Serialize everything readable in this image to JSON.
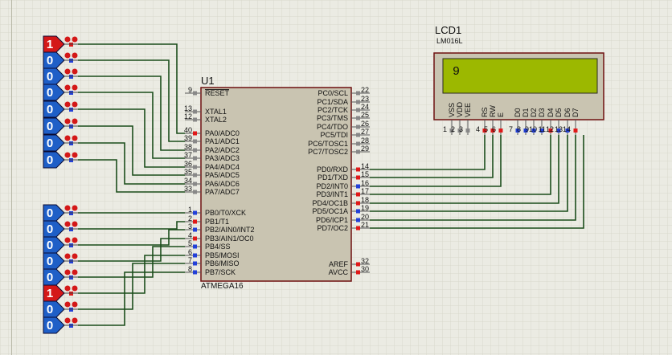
{
  "lcd": {
    "ref": "LCD1",
    "model": "LM016L",
    "display_text": "9",
    "pins": [
      "VSS",
      "VDD",
      "VEE",
      "RS",
      "RW",
      "E",
      "D0",
      "D1",
      "D2",
      "D3",
      "D4",
      "D5",
      "D6",
      "D7"
    ],
    "pin_numbers": [
      "1",
      "2",
      "3",
      "4",
      "5",
      "6",
      "7",
      "8",
      "9",
      "10",
      "11",
      "12",
      "13",
      "14"
    ]
  },
  "mcu": {
    "ref": "U1",
    "model": "ATMEGA16",
    "left_pins": [
      {
        "num": "9",
        "name": "RESET"
      },
      {
        "num": "13",
        "name": "XTAL1"
      },
      {
        "num": "12",
        "name": "XTAL2"
      },
      {
        "num": "40",
        "name": "PA0/ADC0"
      },
      {
        "num": "39",
        "name": "PA1/ADC1"
      },
      {
        "num": "38",
        "name": "PA2/ADC2"
      },
      {
        "num": "37",
        "name": "PA3/ADC3"
      },
      {
        "num": "36",
        "name": "PA4/ADC4"
      },
      {
        "num": "35",
        "name": "PA5/ADC5"
      },
      {
        "num": "34",
        "name": "PA6/ADC6"
      },
      {
        "num": "33",
        "name": "PA7/ADC7"
      },
      {
        "num": "1",
        "name": "PB0/T0/XCK"
      },
      {
        "num": "2",
        "name": "PB1/T1"
      },
      {
        "num": "3",
        "name": "PB2/AIN0/INT2"
      },
      {
        "num": "4",
        "name": "PB3/AIN1/OC0"
      },
      {
        "num": "5",
        "name": "PB4/SS"
      },
      {
        "num": "6",
        "name": "PB5/MOSI"
      },
      {
        "num": "7",
        "name": "PB6/MISO"
      },
      {
        "num": "8",
        "name": "PB7/SCK"
      }
    ],
    "right_pins": [
      {
        "num": "22",
        "name": "PC0/SCL"
      },
      {
        "num": "23",
        "name": "PC1/SDA"
      },
      {
        "num": "24",
        "name": "PC2/TCK"
      },
      {
        "num": "25",
        "name": "PC3/TMS"
      },
      {
        "num": "26",
        "name": "PC4/TDO"
      },
      {
        "num": "27",
        "name": "PC5/TDI"
      },
      {
        "num": "28",
        "name": "PC6/TOSC1"
      },
      {
        "num": "29",
        "name": "PC7/TOSC2"
      },
      {
        "num": "14",
        "name": "PD0/RXD"
      },
      {
        "num": "15",
        "name": "PD1/TXD"
      },
      {
        "num": "16",
        "name": "PD2/INT0"
      },
      {
        "num": "17",
        "name": "PD3/INT1"
      },
      {
        "num": "18",
        "name": "PD4/OC1B"
      },
      {
        "num": "19",
        "name": "PD5/OC1A"
      },
      {
        "num": "20",
        "name": "PD6/ICP1"
      },
      {
        "num": "21",
        "name": "PD7/OC2"
      },
      {
        "num": "32",
        "name": "AREF"
      },
      {
        "num": "30",
        "name": "AVCC"
      }
    ]
  },
  "switches_a": [
    "1",
    "0",
    "0",
    "0",
    "0",
    "0",
    "0",
    "0"
  ],
  "switches_b": [
    "0",
    "0",
    "0",
    "0",
    "0",
    "1",
    "0",
    "0"
  ],
  "colors": {
    "background": "#ebebe3",
    "grid": "#d8d8cc",
    "wire": "#1b4d1b",
    "chip_fill": "#c9c4b1",
    "chip_border": "#6e1010",
    "lcd_body": "#c9c4b1",
    "lcd_screen": "#9cb800",
    "switch_high": "#d41818",
    "switch_low": "#1f5fc7",
    "pin_high": "#e01919",
    "pin_low": "#2340d8"
  }
}
